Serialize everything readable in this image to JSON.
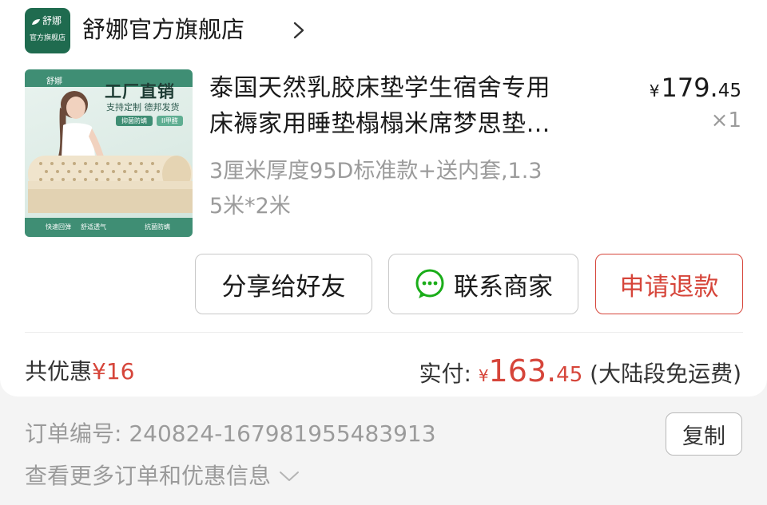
{
  "store": {
    "logo_name": "舒娜",
    "logo_sub": "官方旗舰店",
    "name": "舒娜官方旗舰店"
  },
  "product": {
    "thumbnail": {
      "brand": "舒娜",
      "headline": "工厂直销",
      "subline": "支持定制 德邦发货",
      "tag1": "抑菌防螨",
      "tag2": "II甲醛",
      "features": [
        "快速回弹",
        "舒适透气",
        "抗菌防螨"
      ]
    },
    "title_line1": "泰国天然乳胶床垫学生宿舍专用",
    "title_line2": "床褥家用睡垫榻榻米席梦思垫…",
    "spec_line1": "3厘米厚度95D标准款+送内套,1.3",
    "spec_line2": "5米*2米",
    "price_symbol": "¥",
    "price_int": "179.",
    "price_dec": "45",
    "quantity": "×1"
  },
  "actions": {
    "share": "分享给好友",
    "contact": "联系商家",
    "refund": "申请退款"
  },
  "summary": {
    "discount_label": "共优惠",
    "discount_value": "¥16",
    "paid_label": "实付: ",
    "paid_symbol": "¥",
    "paid_int": "163.",
    "paid_dec": "45",
    "shipping_note": " (大陆段免运费)"
  },
  "order": {
    "number_label": "订单编号: ",
    "number": "240824-167981955483913",
    "copy_label": "复制",
    "more_label": "查看更多订单和优惠信息"
  },
  "colors": {
    "accent": "#d6453a",
    "brand_green": "#1f6b4f"
  }
}
